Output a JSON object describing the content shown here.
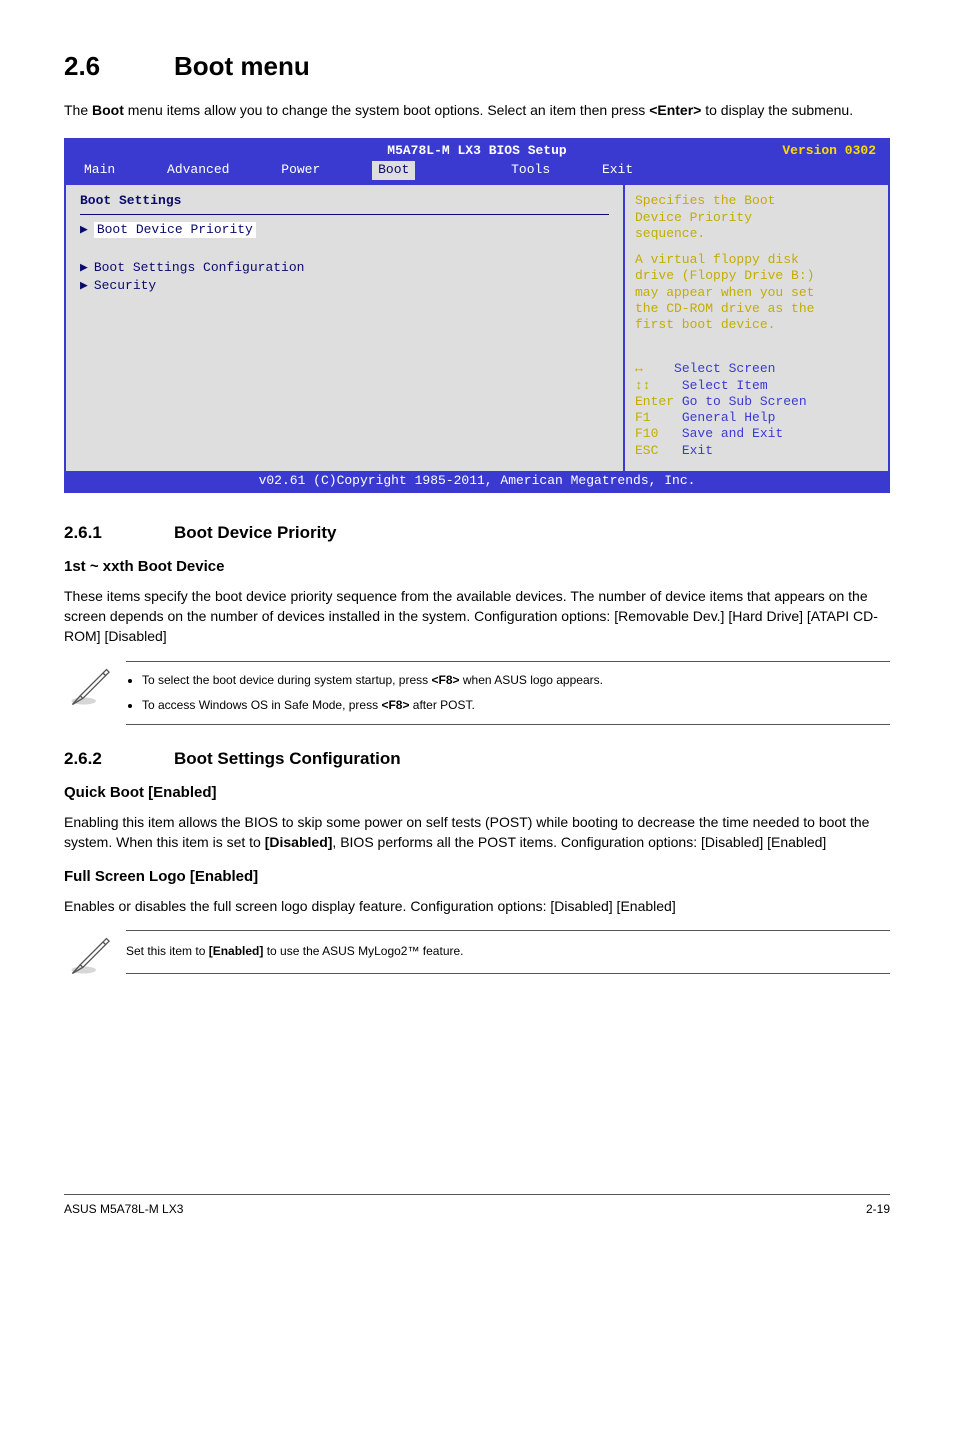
{
  "section": {
    "number": "2.6",
    "title": "Boot menu",
    "intro_1": "The ",
    "intro_boot": "Boot",
    "intro_2": " menu items allow you to change the system boot options. Select an item then press ",
    "intro_enter": "<Enter>",
    "intro_3": " to display the submenu."
  },
  "bios": {
    "title": "M5A78L-M LX3 BIOS Setup",
    "version": "Version 0302",
    "tabs": {
      "main": "Main",
      "advanced": "Advanced",
      "power": "Power",
      "boot": "Boot",
      "tools": "Tools",
      "exit": "Exit"
    },
    "left": {
      "settings": "Boot Settings",
      "bdp": "Boot Device Priority",
      "bsc": "Boot Settings Configuration",
      "sec": "Security"
    },
    "right": {
      "l1": "Specifies the Boot",
      "l2": "Device Priority",
      "l3": "sequence.",
      "l4": "A virtual floppy disk",
      "l5": "drive (Floppy Drive B:)",
      "l6": "may appear when you set",
      "l7": "the CD-ROM drive as the",
      "l8": "first boot device.",
      "k1a": "   ",
      "k1b": "Select Screen",
      "k2a": "   ",
      "k2b": "Select Item",
      "k3a": "Enter",
      "k3b": "Go to Sub Screen",
      "k4a": "F1",
      "k4b": "General Help",
      "k5a": "F10",
      "k5b": "Save and Exit",
      "k6a": "ESC",
      "k6b": "Exit"
    },
    "footer": "v02.61 (C)Copyright 1985-2011, American Megatrends, Inc."
  },
  "sub1": {
    "number": "2.6.1",
    "title": "Boot Device Priority",
    "h3": "1st ~ xxth Boot Device",
    "p": "These items specify the boot device priority sequence from the available devices. The number of device items that appears on the screen depends on the number of devices installed in the system. Configuration options: [Removable Dev.] [Hard Drive] [ATAPI CD-ROM] [Disabled]"
  },
  "note1": {
    "li1a": "To select the boot device during system startup, press ",
    "li1b": "<F8>",
    "li1c": " when ASUS logo appears.",
    "li2a": "To access Windows OS in Safe Mode, press ",
    "li2b": "<F8>",
    "li2c": " after POST."
  },
  "sub2": {
    "number": "2.6.2",
    "title": "Boot Settings Configuration",
    "h3a": "Quick Boot [Enabled]",
    "pa1": "Enabling this item allows the BIOS to skip some power on self tests (POST) while booting to decrease the time needed to boot the system. When this item is set to ",
    "pa_dis": "[Disabled]",
    "pa2": ", BIOS performs all the POST items. Configuration options: [Disabled] [Enabled]",
    "h3b": "Full Screen Logo [Enabled]",
    "pb": "Enables or disables the full screen logo display feature. Configuration options: [Disabled] [Enabled]"
  },
  "note2": {
    "t1": "Set this item to ",
    "t2": "[Enabled]",
    "t3": " to use the ASUS MyLogo2™ feature."
  },
  "footer": {
    "left": "ASUS M5A78L-M LX3",
    "right": "2-19"
  }
}
